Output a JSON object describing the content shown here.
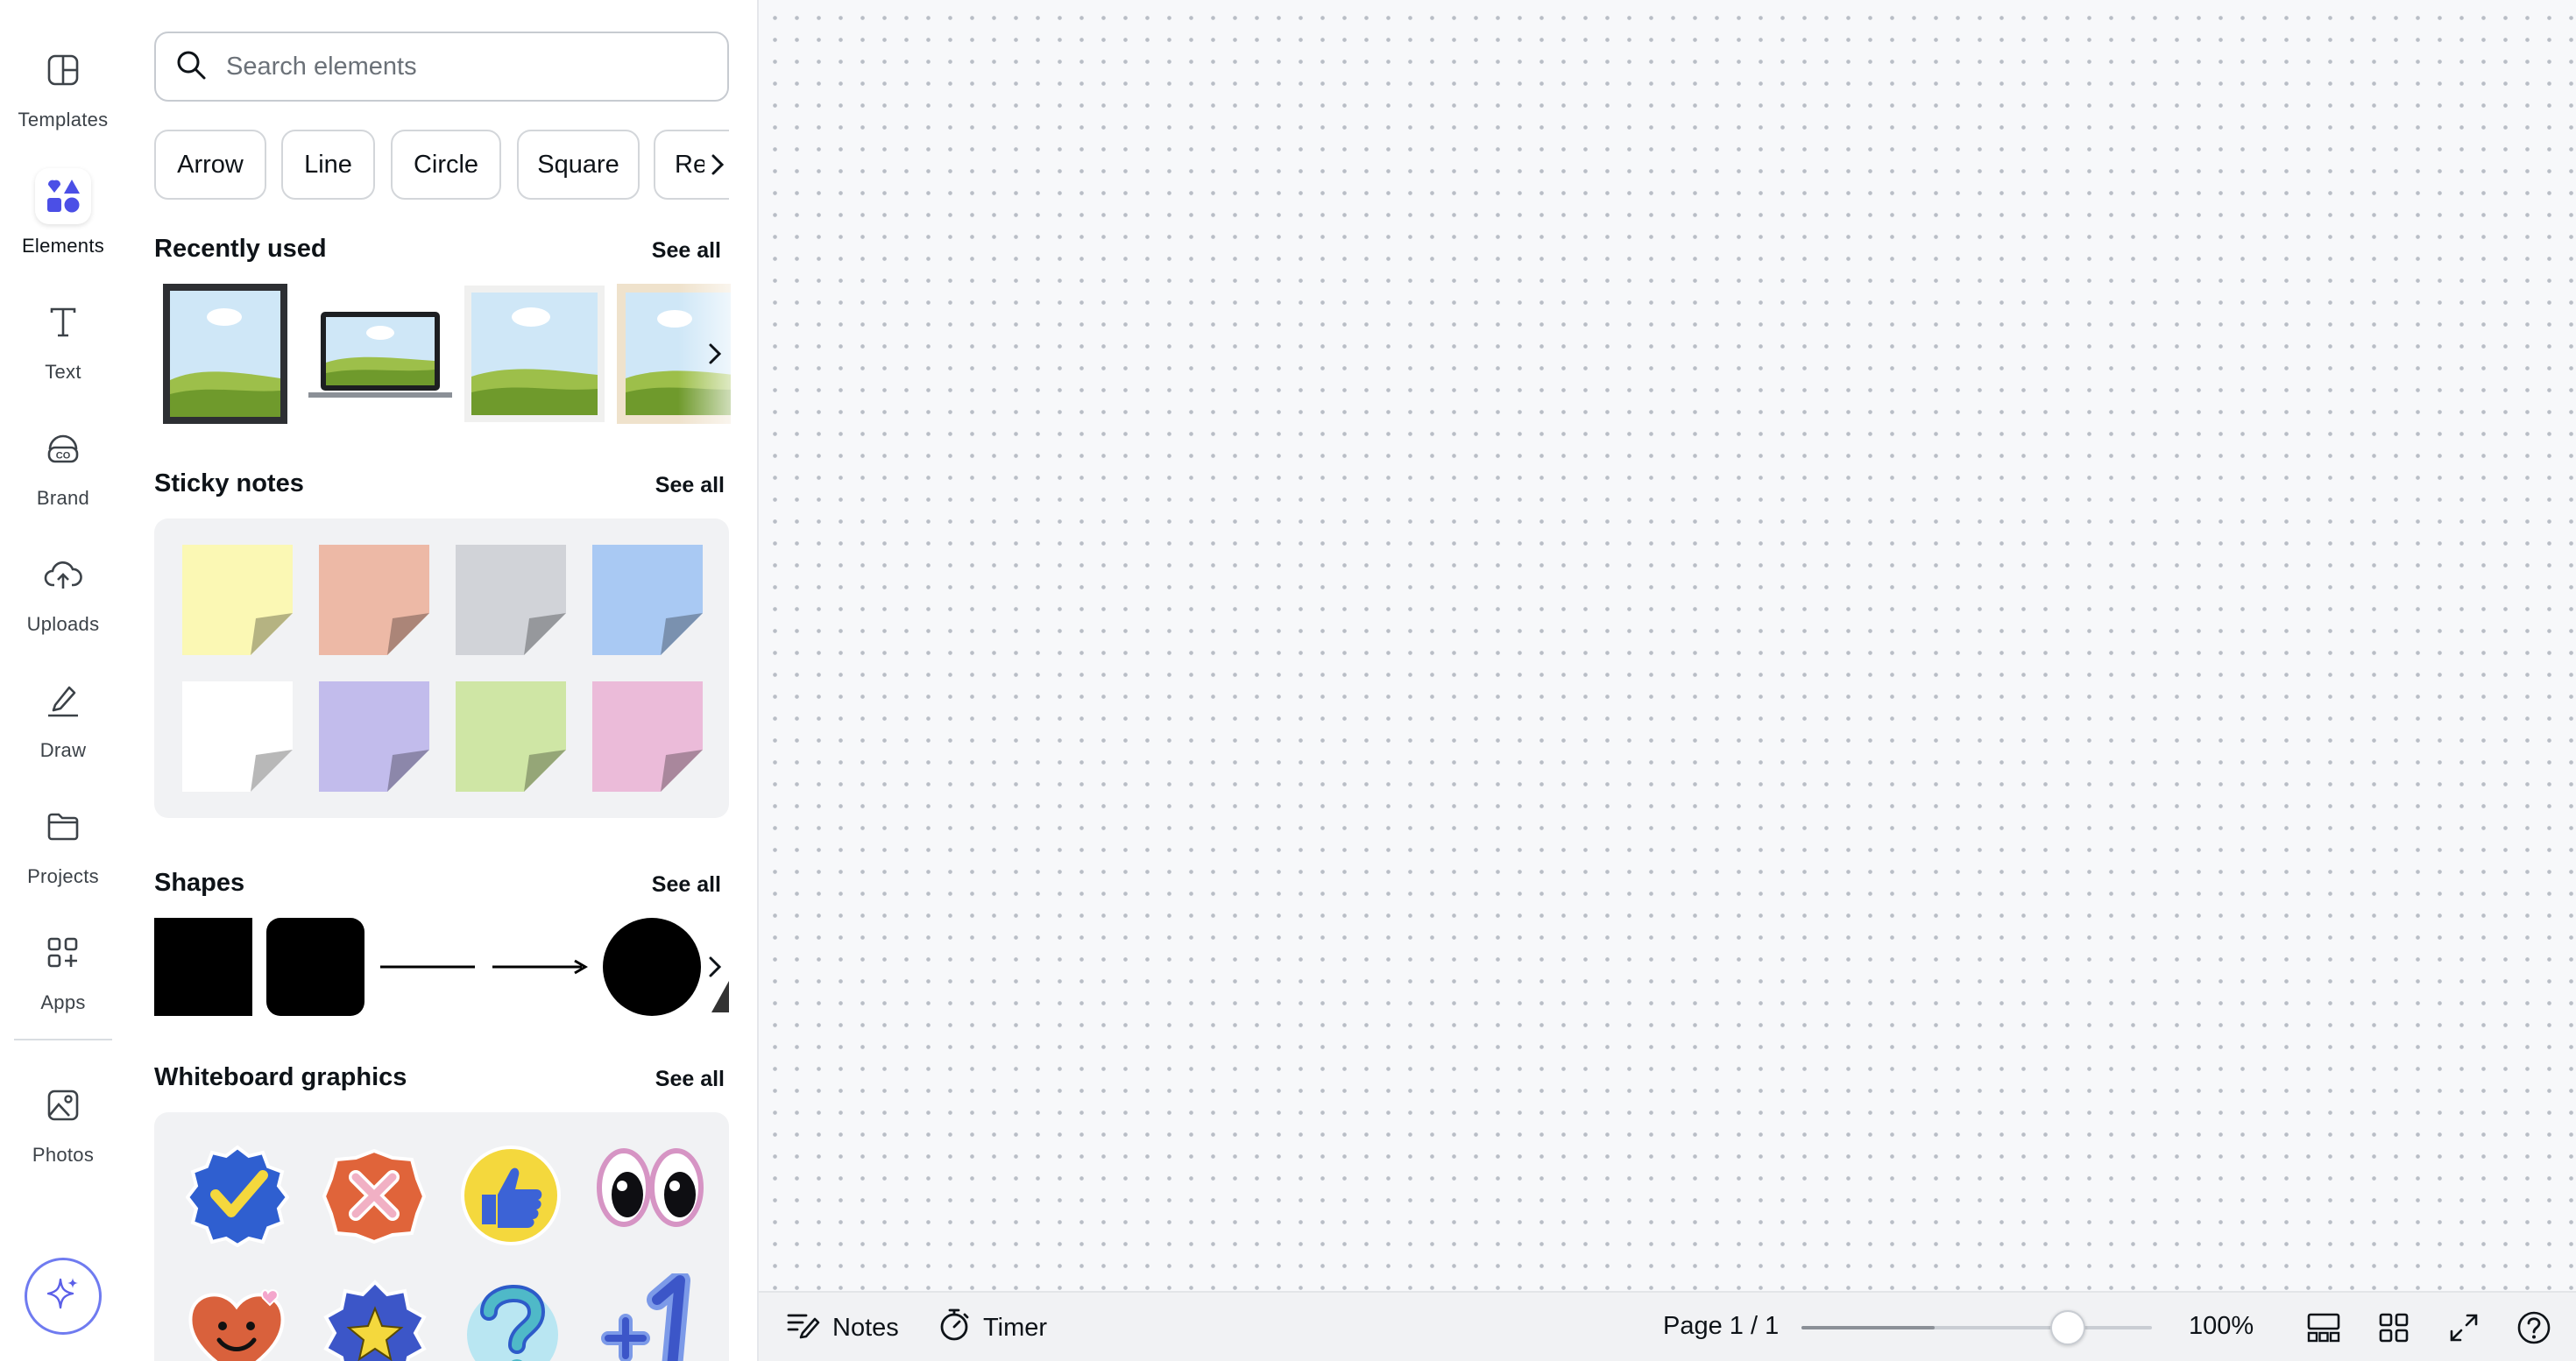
{
  "nav": {
    "items": [
      {
        "label": "Templates",
        "icon": "template-icon"
      },
      {
        "label": "Elements",
        "icon": "elements-icon"
      },
      {
        "label": "Text",
        "icon": "text-icon"
      },
      {
        "label": "Brand",
        "icon": "brand-icon"
      },
      {
        "label": "Uploads",
        "icon": "upload-cloud-icon"
      },
      {
        "label": "Draw",
        "icon": "pen-icon"
      },
      {
        "label": "Projects",
        "icon": "folder-icon"
      },
      {
        "label": "Apps",
        "icon": "apps-icon"
      },
      {
        "label": "Photos",
        "icon": "image-icon"
      }
    ],
    "active": "Elements",
    "magic_icon": "sparkle-icon"
  },
  "panel": {
    "search": {
      "placeholder": "Search elements",
      "value": ""
    },
    "chips": [
      "Arrow",
      "Line",
      "Circle",
      "Square",
      "Rec"
    ],
    "sections": {
      "recently_used": {
        "title": "Recently used",
        "see_all": "See all"
      },
      "sticky_notes": {
        "title": "Sticky notes",
        "see_all": "See all",
        "colors": [
          "#fbf8b4",
          "#edb9a6",
          "#d1d3d8",
          "#a9c9f3",
          "#ffffff",
          "#c2bcec",
          "#cfe6a5",
          "#ebbbd9"
        ]
      },
      "shapes": {
        "title": "Shapes",
        "see_all": "See all"
      },
      "whiteboard_graphics": {
        "title": "Whiteboard graphics",
        "see_all": "See all"
      }
    }
  },
  "bottom_bar": {
    "notes_label": "Notes",
    "timer_label": "Timer",
    "page_indicator": "Page 1 / 1",
    "zoom_label": "100%",
    "zoom_fraction": 0.38
  },
  "colors": {
    "accent": "#7b54ef",
    "elements_icon": "#4b4fe6",
    "canvas": "#f7f8fa"
  }
}
